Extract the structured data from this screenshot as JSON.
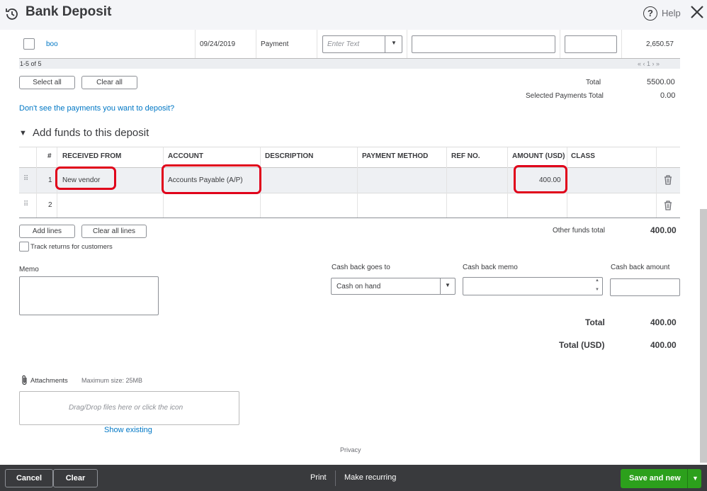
{
  "header": {
    "title": "Bank Deposit",
    "help": "Help"
  },
  "payments": {
    "row": {
      "name": "boo",
      "date": "09/24/2019",
      "type": "Payment",
      "method_placeholder": "Enter Text",
      "amount": "2,650.57"
    },
    "pager": "1-5 of 5",
    "pager_nav": "« ‹ 1 › »",
    "select_all": "Select all",
    "clear_all": "Clear all",
    "total_label": "Total",
    "total_value": "5500.00",
    "selected_label": "Selected Payments Total",
    "selected_value": "0.00",
    "missing_link": "Don't see the payments you want to deposit?"
  },
  "funds": {
    "section_title": "Add funds to this deposit",
    "columns": [
      "#",
      "RECEIVED FROM",
      "ACCOUNT",
      "DESCRIPTION",
      "PAYMENT METHOD",
      "REF NO.",
      "AMOUNT (USD)",
      "CLASS"
    ],
    "rows": [
      {
        "num": "1",
        "received_from": "New vendor",
        "account": "Accounts Payable (A/P)",
        "amount": "400.00"
      },
      {
        "num": "2",
        "received_from": "",
        "account": "",
        "amount": ""
      }
    ],
    "add_lines": "Add lines",
    "clear_all_lines": "Clear all lines",
    "other_total_label": "Other funds total",
    "other_total_value": "400.00",
    "track_returns": "Track returns for customers"
  },
  "memo": {
    "label": "Memo"
  },
  "cashback": {
    "goes_to_label": "Cash back goes to",
    "goes_to_value": "Cash on hand",
    "memo_label": "Cash back memo",
    "amount_label": "Cash back amount"
  },
  "totals": {
    "total_label": "Total",
    "total_value": "400.00",
    "total_usd_label": "Total (USD)",
    "total_usd_value": "400.00"
  },
  "attachments": {
    "label": "Attachments",
    "max_size": "Maximum size: 25MB",
    "drop_text": "Drag/Drop files here or click the icon",
    "show_existing": "Show existing"
  },
  "privacy": "Privacy",
  "footer": {
    "cancel": "Cancel",
    "clear": "Clear",
    "print": "Print",
    "make_recurring": "Make recurring",
    "save_new": "Save and new"
  },
  "colors": {
    "accent_green": "#2ca01c",
    "link_blue": "#0077c5",
    "highlight_red": "#e0001a",
    "footer_bg": "#393a3d"
  }
}
